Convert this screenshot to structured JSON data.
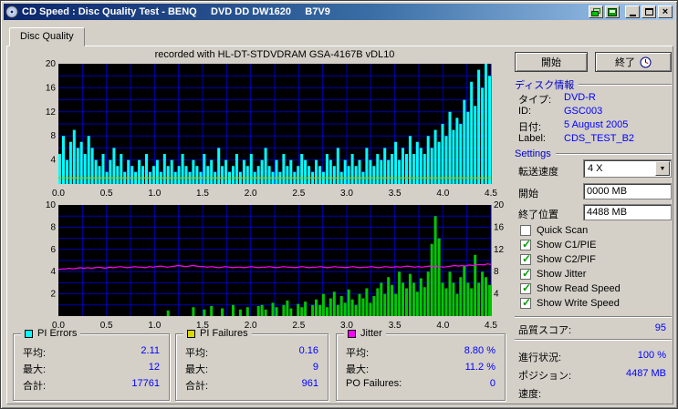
{
  "colors": {
    "titlebar_left": "#0a246a",
    "titlebar_right": "#a6caf0",
    "window_chrome": "#d4d0c8",
    "value_text": "#0000ff",
    "section_header": "#0000c8",
    "chart_background": "#000000",
    "chart_grid": "#0000b4",
    "pi_errors": "#00ffff",
    "pi_failures_yellow": "#b8b800",
    "pi_failures_green": "#00c800",
    "jitter": "#ff00ff",
    "check_green": "#00a000"
  },
  "titlebar": {
    "title": "CD Speed : Disc Quality Test - BENQ     DVD DD DW1620     B7V9"
  },
  "tab": {
    "label": "Disc Quality"
  },
  "chart_header": "recorded with HL-DT-STDVDRAM GSA-4167B vDL10",
  "right_panel": {
    "start_button": "開始",
    "exit_button": "終了",
    "disc_info": {
      "header": "ディスク情報",
      "rows": [
        {
          "label": "タイプ:",
          "value": "DVD-R"
        },
        {
          "label": "ID:",
          "value": "GSC003"
        },
        {
          "label": "日付:",
          "value": "5 August 2005"
        },
        {
          "label": "Label:",
          "value": "CDS_TEST_B2"
        }
      ]
    },
    "settings": {
      "header": "Settings",
      "speed_label": "転送速度",
      "speed_value": "4 X",
      "start_label": "開始",
      "start_value": "0000 MB",
      "end_label": "終了位置",
      "end_value": "4488 MB"
    },
    "checkboxes": [
      {
        "label": "Quick Scan",
        "checked": false
      },
      {
        "label": "Show C1/PIE",
        "checked": true
      },
      {
        "label": "Show C2/PIF",
        "checked": true
      },
      {
        "label": "Show Jitter",
        "checked": true
      },
      {
        "label": "Show Read Speed",
        "checked": true
      },
      {
        "label": "Show Write Speed",
        "checked": true
      }
    ],
    "quality_score": {
      "label": "品質スコア:",
      "value": "95"
    },
    "status_rows": [
      {
        "label": "進行状況:",
        "value": "100 %"
      },
      {
        "label": "ポジション:",
        "value": "4487 MB"
      },
      {
        "label": "速度:",
        "value": ""
      }
    ]
  },
  "stats": [
    {
      "title": "PI Errors",
      "color": "#00ffff",
      "rows": [
        {
          "label": "平均:",
          "value": "2.11"
        },
        {
          "label": "最大:",
          "value": "12"
        },
        {
          "label": "合計:",
          "value": "17761"
        }
      ]
    },
    {
      "title": "PI Failures",
      "color": "#d8d800",
      "rows": [
        {
          "label": "平均:",
          "value": "0.16"
        },
        {
          "label": "最大:",
          "value": "9"
        },
        {
          "label": "合計:",
          "value": "961"
        }
      ]
    },
    {
      "title": "Jitter",
      "color": "#ff00ff",
      "rows": [
        {
          "label": "平均:",
          "value": "8.80 %"
        },
        {
          "label": "最大:",
          "value": "11.2 %"
        },
        {
          "label": "PO Failures:",
          "value": "0"
        }
      ]
    }
  ],
  "chart_data": [
    {
      "type": "area",
      "name": "PI Errors vs disc position (GB)",
      "x_range": [
        0,
        4.5
      ],
      "grid_x": 0.25,
      "grid_y": 2,
      "x_ticks": [
        "0.0",
        "0.5",
        "1.0",
        "1.5",
        "2.0",
        "2.5",
        "3.0",
        "3.5",
        "4.0",
        "4.5"
      ],
      "y_left": {
        "range": [
          0,
          20
        ],
        "ticks": [
          4,
          8,
          12,
          16,
          20
        ]
      },
      "series": [
        {
          "name": "PI Errors",
          "color": "#00ffff",
          "style": "bars",
          "axis": "left",
          "values": [
            5,
            8,
            4,
            7,
            9,
            6,
            7,
            5,
            8,
            6,
            4,
            3,
            5,
            2,
            4,
            6,
            3,
            5,
            2,
            4,
            3,
            2,
            4,
            3,
            5,
            2,
            3,
            4,
            2,
            5,
            3,
            4,
            2,
            3,
            5,
            3,
            2,
            4,
            3,
            2,
            5,
            3,
            4,
            2,
            6,
            3,
            4,
            2,
            3,
            5,
            2,
            4,
            3,
            5,
            2,
            3,
            4,
            6,
            3,
            2,
            4,
            2,
            5,
            3,
            4,
            2,
            3,
            5,
            4,
            3,
            2,
            4,
            3,
            2,
            5,
            4,
            3,
            6,
            2,
            4,
            3,
            5,
            3,
            4,
            2,
            6,
            4,
            3,
            5,
            4,
            6,
            4,
            5,
            7,
            4,
            6,
            5,
            8,
            5,
            7,
            6,
            5,
            8,
            6,
            9,
            7,
            10,
            8,
            12,
            9,
            11,
            10,
            14,
            12,
            17,
            13,
            19,
            16,
            20,
            18
          ]
        },
        {
          "name": "PI Failures",
          "color": "#b8b800",
          "style": "hline",
          "axis": "left",
          "value": 1
        }
      ]
    },
    {
      "type": "line",
      "name": "PI Failures (left axis) and Jitter % (right axis) vs disc position (GB)",
      "x_range": [
        0,
        4.5
      ],
      "grid_x": 0.25,
      "grid_y": 1,
      "x_ticks": [
        "0.0",
        "0.5",
        "1.0",
        "1.5",
        "2.0",
        "2.5",
        "3.0",
        "3.5",
        "4.0",
        "4.5"
      ],
      "y_left": {
        "range": [
          0,
          10
        ],
        "ticks": [
          2,
          4,
          6,
          8,
          10
        ]
      },
      "y_right": {
        "range": [
          0,
          20
        ],
        "ticks": [
          4,
          8,
          12,
          16,
          20
        ]
      },
      "series": [
        {
          "name": "PI Failures",
          "color": "#00c800",
          "style": "bars",
          "axis": "left",
          "values": [
            0,
            0,
            0,
            0,
            0,
            0,
            0,
            0,
            0,
            0,
            0,
            0,
            0,
            0,
            0,
            0,
            0,
            0,
            0,
            0,
            0,
            0,
            0,
            0,
            0,
            0,
            0,
            0,
            0,
            0,
            0.5,
            0,
            0,
            0,
            0,
            0,
            0,
            0.8,
            0,
            0,
            0.6,
            0,
            0.9,
            0,
            0,
            0.7,
            0,
            0,
            1,
            0,
            0.6,
            0,
            0.8,
            0,
            0,
            0.9,
            1,
            0.6,
            0,
            1.2,
            0.8,
            0,
            1,
            1.4,
            0.7,
            0,
            1.1,
            0.8,
            1.3,
            0,
            1,
            1.5,
            1,
            2,
            0.8,
            1.6,
            2.2,
            1,
            1.8,
            1.2,
            2.4,
            1.5,
            1,
            2,
            1.6,
            2.5,
            1.2,
            1.8,
            2.5,
            3,
            2,
            3.5,
            2.8,
            2,
            4,
            3,
            2.5,
            3.8,
            3,
            2.2,
            3.4,
            2.6,
            4,
            6.5,
            9,
            7,
            3,
            2.5,
            4,
            3,
            2,
            3.5,
            4.5,
            3,
            2.5,
            5.5,
            3,
            4,
            3.5,
            2.8
          ]
        },
        {
          "name": "Jitter",
          "color": "#ff00ff",
          "style": "line",
          "axis": "right",
          "values": [
            8.4,
            8.5,
            8.5,
            8.6,
            8.5,
            8.6,
            8.7,
            8.6,
            8.7,
            8.6,
            8.7,
            8.8,
            8.7,
            8.6,
            8.8,
            8.7,
            8.8,
            8.9,
            8.8,
            8.7,
            8.8,
            8.9,
            8.8,
            8.8,
            8.7,
            8.9,
            8.8,
            8.9,
            9.0,
            8.9,
            8.8,
            8.9,
            9.0,
            9.1,
            9.0,
            8.9,
            9.0,
            9.1,
            9.0,
            8.9,
            8.9,
            8.8,
            8.9,
            8.8,
            8.7,
            8.8,
            8.9,
            8.8,
            8.7,
            8.8,
            8.8,
            8.7,
            8.8,
            8.9,
            8.8,
            8.7,
            8.8,
            8.8,
            8.9,
            8.8,
            8.7,
            8.8,
            8.9,
            8.8,
            8.8,
            8.7,
            8.8,
            8.9,
            8.8,
            8.7,
            8.8,
            8.8,
            8.9,
            8.8,
            8.7,
            8.8,
            8.9,
            8.8,
            8.8,
            8.7,
            8.8,
            8.9,
            8.8,
            8.7,
            8.8,
            8.8,
            8.9,
            8.8,
            8.7,
            8.8,
            8.9,
            8.8,
            8.8,
            8.9,
            8.8,
            8.9,
            9.0,
            8.9,
            8.8,
            8.9,
            8.8,
            8.9,
            9.0,
            8.9,
            9.0,
            8.9,
            8.8,
            8.9,
            9.0,
            9.1,
            9.0,
            9.1,
            9.0,
            9.2,
            9.1,
            9.2,
            9.3,
            9.2,
            9.4,
            9.3
          ]
        }
      ]
    }
  ]
}
